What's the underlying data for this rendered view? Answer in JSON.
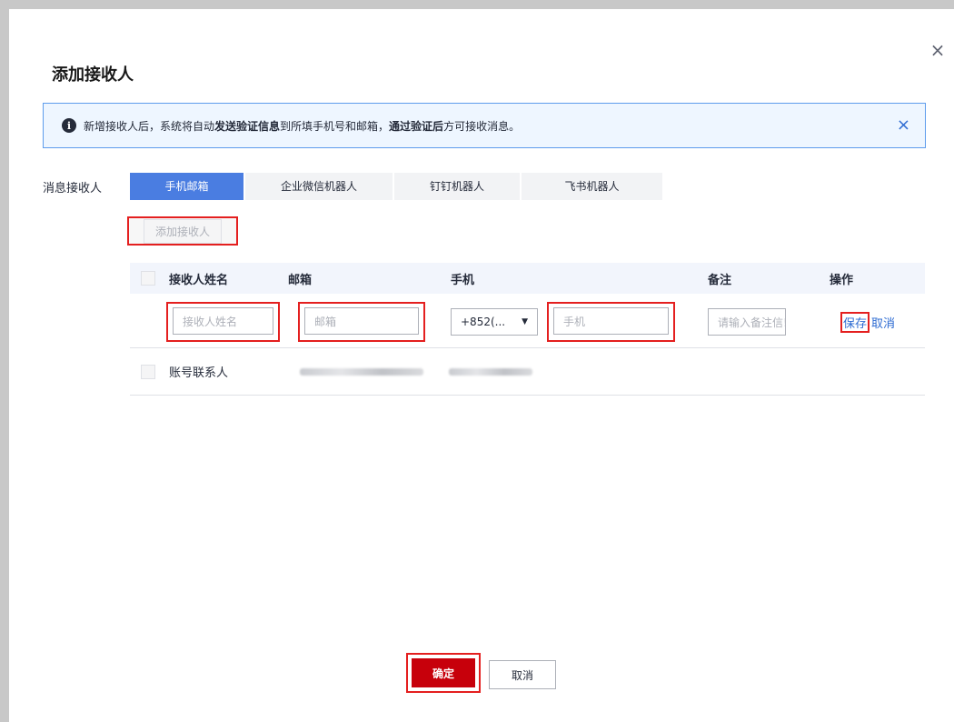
{
  "dialog": {
    "title": "添加接收人",
    "close_icon": "close-icon"
  },
  "notice": {
    "text_1": "新增接收人后，系统将自动 ",
    "bold_1": "发送验证信息",
    "text_2": " 到所填手机号和邮箱，",
    "bold_2": "通过验证后",
    "text_3": " 方可接收消息。",
    "icon": "info-icon"
  },
  "form": {
    "recipient_label": "消息接收人",
    "tabs": [
      {
        "label": "手机邮箱",
        "active": true
      },
      {
        "label": "企业微信机器人",
        "active": false
      },
      {
        "label": "钉钉机器人",
        "active": false
      },
      {
        "label": "飞书机器人",
        "active": false
      }
    ],
    "add_recipient_label": "添加接收人"
  },
  "table": {
    "headers": [
      "接收人姓名",
      "邮箱",
      "手机",
      "备注",
      "操作"
    ],
    "edit_row": {
      "name_placeholder": "接收人姓名",
      "email_placeholder": "邮箱",
      "country_code": "+852(...",
      "phone_placeholder": "手机",
      "note_placeholder": "请输入备注信!",
      "save_label": "保存",
      "cancel_label": "取消"
    },
    "rows": [
      {
        "name": "账号联系人"
      }
    ]
  },
  "footer": {
    "ok_label": "确定",
    "cancel_label": "取消"
  },
  "colors": {
    "primary": "#c7000b",
    "tab_active": "#4a7de1",
    "link": "#2d6bd2",
    "highlight_box": "#e41f1f"
  }
}
